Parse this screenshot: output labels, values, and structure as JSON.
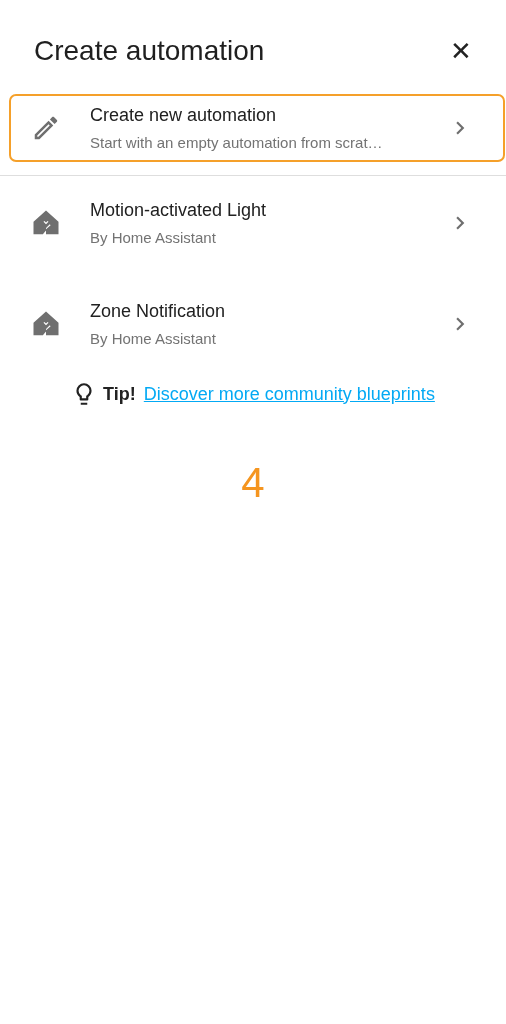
{
  "dialog": {
    "title": "Create automation",
    "close": "✕"
  },
  "items": [
    {
      "kind": "new",
      "title": "Create new automation",
      "subtitle": "Start with an empty automation from scrat…",
      "selected": true
    },
    {
      "kind": "blueprint",
      "title": "Motion-activated Light",
      "subtitle": "By Home Assistant",
      "selected": false
    },
    {
      "kind": "blueprint",
      "title": "Zone Notification",
      "subtitle": "By Home Assistant",
      "selected": false
    }
  ],
  "tip": {
    "label": "Tip!",
    "link": "Discover more community blueprints"
  },
  "marker": "4"
}
